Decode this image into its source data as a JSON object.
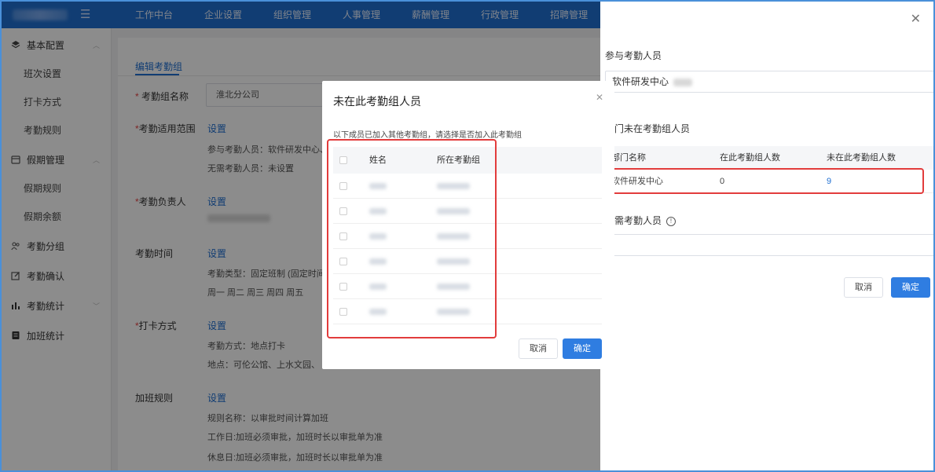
{
  "topbar": {
    "menu_icon": "menu-icon",
    "nav": [
      "工作中台",
      "企业设置",
      "组织管理",
      "人事管理",
      "薪酬管理",
      "行政管理",
      "招聘管理"
    ]
  },
  "sidebar": {
    "groups": [
      {
        "label": "基本配置",
        "icon": "layers-icon",
        "expanded": true,
        "items": [
          "班次设置",
          "打卡方式",
          "考勤规则"
        ]
      },
      {
        "label": "假期管理",
        "icon": "calendar-icon",
        "expanded": true,
        "items": [
          "假期规则",
          "假期余额"
        ]
      },
      {
        "label": "考勤分组",
        "icon": "users-icon"
      },
      {
        "label": "考勤确认",
        "icon": "edit-icon"
      },
      {
        "label": "考勤统计",
        "icon": "bar-chart-icon",
        "expanded": false
      },
      {
        "label": "加班统计",
        "icon": "doc-icon"
      }
    ]
  },
  "main": {
    "tab": "编辑考勤组",
    "name_label": "考勤组名称",
    "name_value": "淮北分公司",
    "scope_label": "考勤适用范围",
    "set": "设置",
    "scope_participants": "参与考勤人员：软件研发中心、王",
    "scope_exempt": "无需考勤人员：未设置",
    "owner_label": "考勤负责人",
    "time_label": "考勤时间",
    "time_type": "考勤类型：固定班制 (固定时间上",
    "time_days": "周一  周二  周三  周四  周五",
    "punch_label": "打卡方式",
    "punch_method": "考勤方式：地点打卡",
    "punch_location": "地点：可伦公馆、上水文园、",
    "overtime_label": "加班规则",
    "overtime_name": "规则名称：以审批时间计算加班",
    "overtime_workday": "工作日:加班必须审批，加班时长以审批单为准",
    "overtime_rest": "休息日:加班必须审批，加班时长以审批单为准"
  },
  "drawer": {
    "participants_title": "参与考勤人员",
    "participants_tag": "软件研发中心",
    "not_in_title": "部门未在考勤组人员",
    "table_headers": [
      "部门名称",
      "在此考勤组人数",
      "未在此考勤组人数"
    ],
    "table_rows": [
      {
        "dept": "软件研发中心",
        "in": "0",
        "not_in": "9"
      }
    ],
    "exempt_title": "无需考勤人员",
    "cancel": "取消",
    "confirm": "确定"
  },
  "modal": {
    "title": "未在此考勤组人员",
    "desc": "以下成员已加入其他考勤组，请选择是否加入此考勤组",
    "headers": [
      "姓名",
      "所在考勤组"
    ],
    "rows": 6,
    "cancel": "取消",
    "confirm": "确定"
  },
  "colors": {
    "brand": "#1f6fd1",
    "primary_button": "#2f7de1",
    "highlight_box": "#e23c3c"
  }
}
